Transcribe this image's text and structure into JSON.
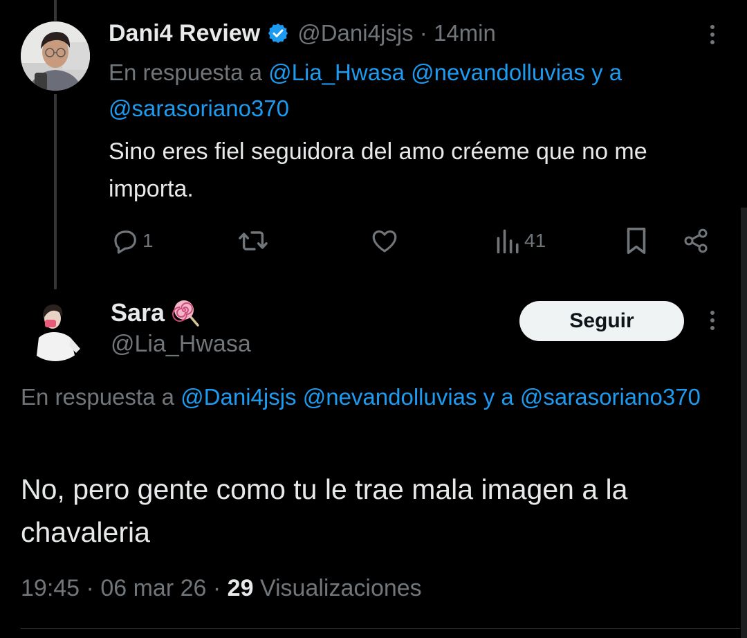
{
  "tweet1": {
    "display_name": "Dani4 Review",
    "handle": "@Dani4jsjs",
    "separator": "·",
    "time": "14min",
    "reply_prefix": "En respuesta a",
    "reply_mentions": [
      "@Lia_Hwasa",
      "@nevandolluvias"
    ],
    "reply_conjunction": "y a",
    "reply_last_mention": "@sarasoriano370",
    "text": "Sino eres fiel seguidora del amo créeme que no me importa.",
    "actions": {
      "replies": "1",
      "views": "41"
    }
  },
  "tweet2": {
    "display_name": "Sara",
    "handle": "@Lia_Hwasa",
    "follow_label": "Seguir",
    "reply_prefix": "En respuesta a",
    "reply_mentions": [
      "@Dani4jsjs",
      "@nevandolluvias"
    ],
    "reply_conjunction": "y a",
    "reply_last_mention": "@sarasoriano370",
    "text": "No, pero gente como tu le trae mala imagen a la chavaleria",
    "time": "19:45",
    "date": "06 mar 26",
    "separator": "·",
    "views_count": "29",
    "views_label": "Visualizaciones"
  },
  "icons": {
    "verified": "verified-badge-icon",
    "lollipop": "lollipop-emoji-icon",
    "reply": "reply-bubble-icon",
    "retweet": "retweet-icon",
    "like": "heart-icon",
    "views": "views-chart-icon",
    "bookmark": "bookmark-icon",
    "share": "share-icon",
    "more": "more-vertical-icon"
  },
  "colors": {
    "background": "#000000",
    "text": "#e7e9ea",
    "muted": "#71767b",
    "link": "#1d9bf0",
    "button_bg": "#eff3f4"
  }
}
